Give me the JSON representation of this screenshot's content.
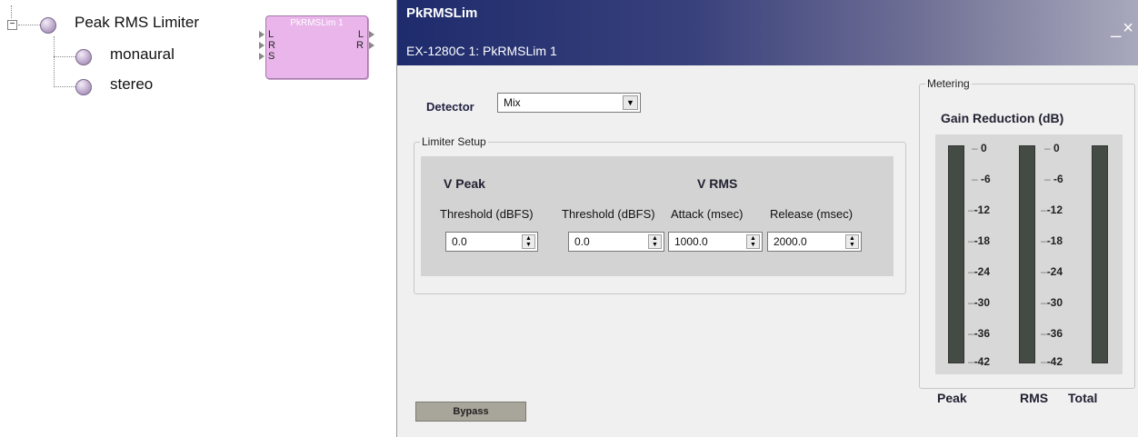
{
  "tree": {
    "root": "Peak RMS Limiter",
    "expander": "−",
    "children": [
      "monaural",
      "stereo"
    ]
  },
  "block": {
    "title": "PkRMSLim 1",
    "inputs": [
      "L",
      "R",
      "S"
    ],
    "outputs": [
      "L",
      "R"
    ]
  },
  "window": {
    "title": "PkRMSLim",
    "subtitle": "EX-1280C 1: PkRMSLim 1",
    "controls": "_×"
  },
  "detector": {
    "label": "Detector",
    "value": "Mix",
    "arrow": "▼"
  },
  "limiter_setup": {
    "label": "Limiter Setup",
    "v_peak": "V Peak",
    "v_rms": "V RMS",
    "fields": [
      {
        "label": "Threshold (dBFS)",
        "value": "0.0"
      },
      {
        "label": "Threshold (dBFS)",
        "value": "0.0"
      },
      {
        "label": "Attack (msec)",
        "value": "1000.0"
      },
      {
        "label": "Release (msec)",
        "value": "2000.0"
      }
    ]
  },
  "bypass_label": "Bypass",
  "metering": {
    "label": "Metering",
    "title": "Gain Reduction (dB)",
    "scale": [
      "0",
      "-6",
      "-12",
      "-18",
      "-24",
      "-30",
      "-36",
      "-42"
    ],
    "meters": [
      "Peak",
      "RMS",
      "Total"
    ]
  },
  "colors": {
    "titlebar_start": "#1e2b6c",
    "block_fill": "#e9b5ea",
    "meter_bar": "#444b44"
  }
}
